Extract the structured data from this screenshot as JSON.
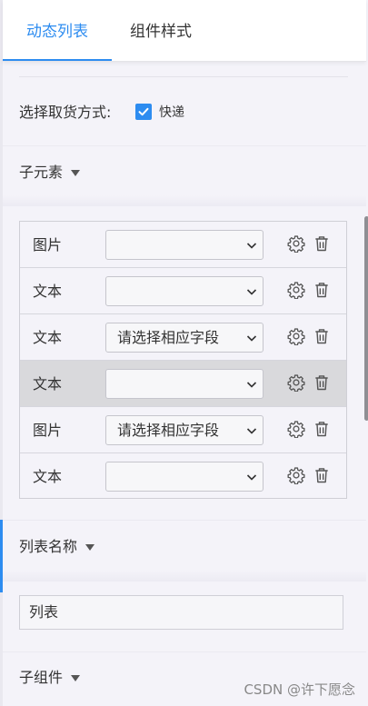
{
  "tabs": [
    {
      "label": "动态列表",
      "active": true
    },
    {
      "label": "组件样式",
      "active": false
    }
  ],
  "pickup": {
    "label": "选择取货方式:",
    "option_label": "快递",
    "checked": true
  },
  "sections": {
    "children": "子元素",
    "list_name": "列表名称",
    "sub_components": "子组件"
  },
  "rows": [
    {
      "type": "图片",
      "select_value": ""
    },
    {
      "type": "文本",
      "select_value": ""
    },
    {
      "type": "文本",
      "select_value": "请选择相应字段"
    },
    {
      "type": "文本",
      "select_value": ""
    },
    {
      "type": "图片",
      "select_value": "请选择相应字段"
    },
    {
      "type": "文本",
      "select_value": ""
    }
  ],
  "list_name_input": {
    "value": "列表"
  },
  "watermark": "CSDN @许下愿念",
  "colors": {
    "accent": "#2d8cf0",
    "highlight_row": "#d9d9dc"
  }
}
